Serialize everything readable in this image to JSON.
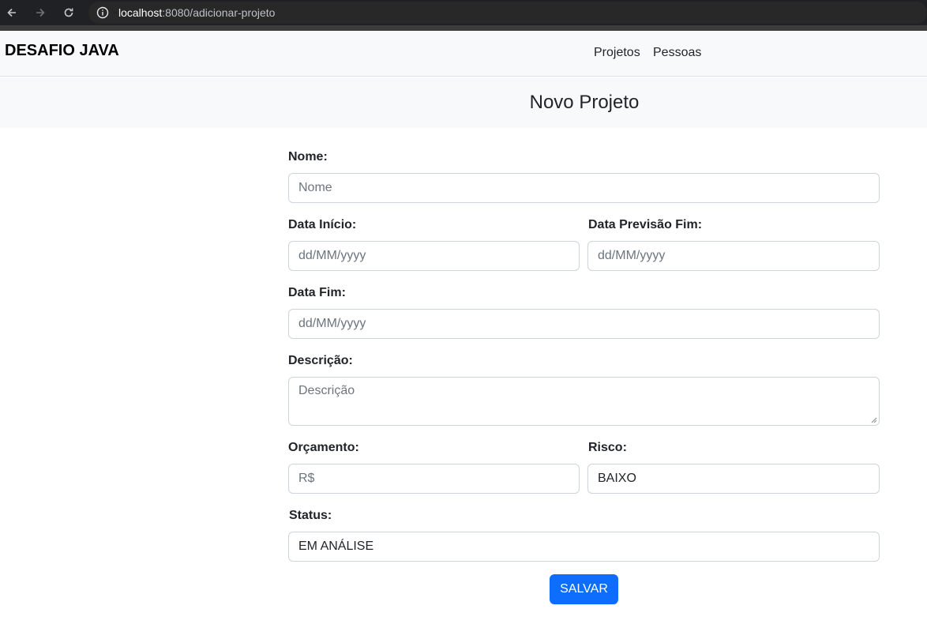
{
  "browser": {
    "url_host": "localhost",
    "url_rest": ":8080/adicionar-projeto"
  },
  "header": {
    "brand": "DESAFIO JAVA",
    "nav": [
      "Projetos",
      "Pessoas"
    ]
  },
  "page": {
    "title": "Novo Projeto"
  },
  "form": {
    "nome_label": "Nome:",
    "nome_placeholder": "Nome",
    "data_inicio_label": "Data Início:",
    "data_inicio_placeholder": "dd/MM/yyyy",
    "data_previsao_fim_label": "Data Previsão Fim:",
    "data_previsao_fim_placeholder": "dd/MM/yyyy",
    "data_fim_label": "Data Fim:",
    "data_fim_placeholder": "dd/MM/yyyy",
    "descricao_label": "Descrição:",
    "descricao_placeholder": "Descrição",
    "orcamento_label": "Orçamento:",
    "orcamento_placeholder": "R$",
    "risco_label": "Risco:",
    "risco_value": "BAIXO",
    "status_label": "Status:",
    "status_value": "EM ANÁLISE",
    "save_label": "SALVAR"
  },
  "colors": {
    "primary": "#0d6efd",
    "header_bg": "#f8f9fa"
  }
}
